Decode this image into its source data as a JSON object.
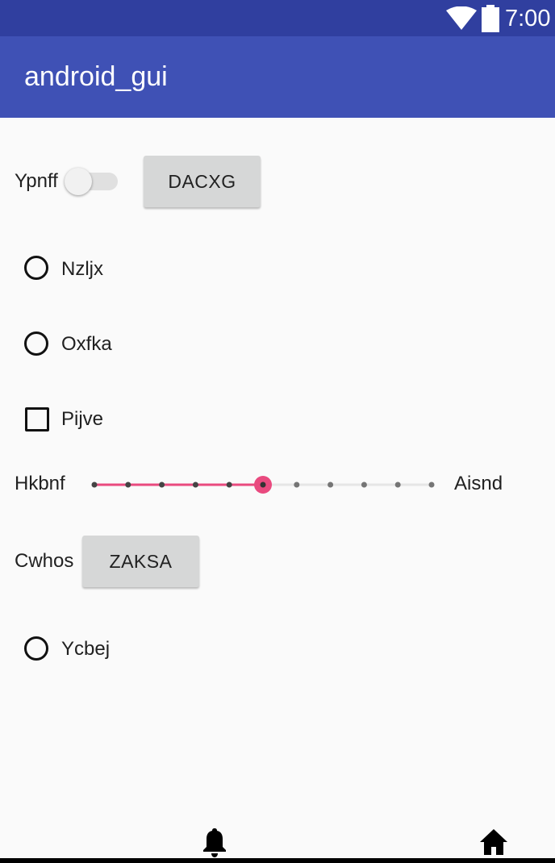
{
  "status_bar": {
    "time": "7:00",
    "icons": [
      "wifi-icon",
      "battery-icon"
    ]
  },
  "app_bar": {
    "title": "android_gui"
  },
  "controls": {
    "switch_label": "Ypnff",
    "switch_on": false,
    "button1_label": "DACXG",
    "radio1_label": "Nzljx",
    "radio1_checked": false,
    "radio2_label": "Oxfka",
    "radio2_checked": false,
    "checkbox_label": "Pijve",
    "checkbox_checked": false,
    "seekbar_left_label": "Hkbnf",
    "seekbar_right_label": "Aisnd",
    "seekbar": {
      "min": 0,
      "max": 10,
      "value": 5
    },
    "button2_prefix_label": "Cwhos",
    "button2_label": "ZAKSA",
    "radio3_label": "Ycbej",
    "radio3_checked": false
  },
  "nav": {
    "icons": [
      "bell-icon",
      "home-icon"
    ]
  },
  "colors": {
    "status_bar": "#303f9f",
    "app_bar": "#3f51b5",
    "accent": "#ff4081",
    "seek_active": "#e94a7f"
  }
}
